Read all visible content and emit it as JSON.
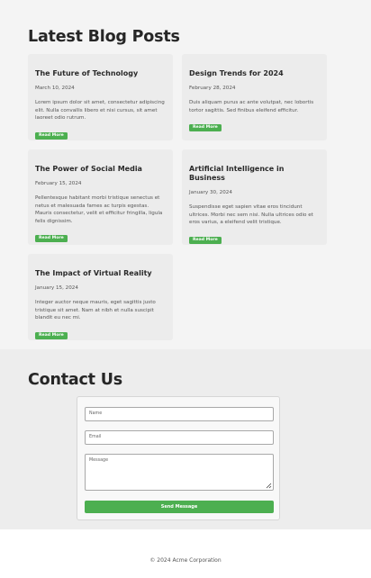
{
  "blog": {
    "title": "Latest Blog Posts",
    "read_more_label": "Read More",
    "posts": [
      {
        "title": "The Future of Technology",
        "date": "March 10, 2024",
        "excerpt": "Lorem ipsum dolor sit amet, consectetur adipiscing elit. Nulla convallis libero et nisi cursus, sit amet laoreet odio rutrum."
      },
      {
        "title": "Design Trends for 2024",
        "date": "February 28, 2024",
        "excerpt": "Duis aliquam purus ac ante volutpat, nec lobortis tortor sagittis. Sed finibus eleifend efficitur."
      },
      {
        "title": "The Power of Social Media",
        "date": "February 15, 2024",
        "excerpt": "Pellentesque habitant morbi tristique senectus et netus et malesuada fames ac turpis egestas. Mauris consectetur, velit et efficitur fringilla, ligula felis dignissim."
      },
      {
        "title": "Artificial Intelligence in Business",
        "date": "January 30, 2024",
        "excerpt": "Suspendisse eget sapien vitae eros tincidunt ultrices. Morbi nec sem nisi. Nulla ultrices odio et eros varius, a eleifend velit tristique."
      },
      {
        "title": "The Impact of Virtual Reality",
        "date": "January 15, 2024",
        "excerpt": "Integer auctor neque mauris, eget sagittis justo tristique sit amet. Nam at nibh et nulla suscipit blandit eu nec mi."
      }
    ]
  },
  "contact": {
    "title": "Contact Us",
    "name_placeholder": "Name",
    "email_placeholder": "Email",
    "message_placeholder": "Message",
    "send_label": "Send Message"
  },
  "footer": {
    "text": "© 2024 Acme Corporation"
  },
  "colors": {
    "accent": "#4caf50",
    "card_bg": "#ececec",
    "section_bg": "#f4f4f4"
  }
}
